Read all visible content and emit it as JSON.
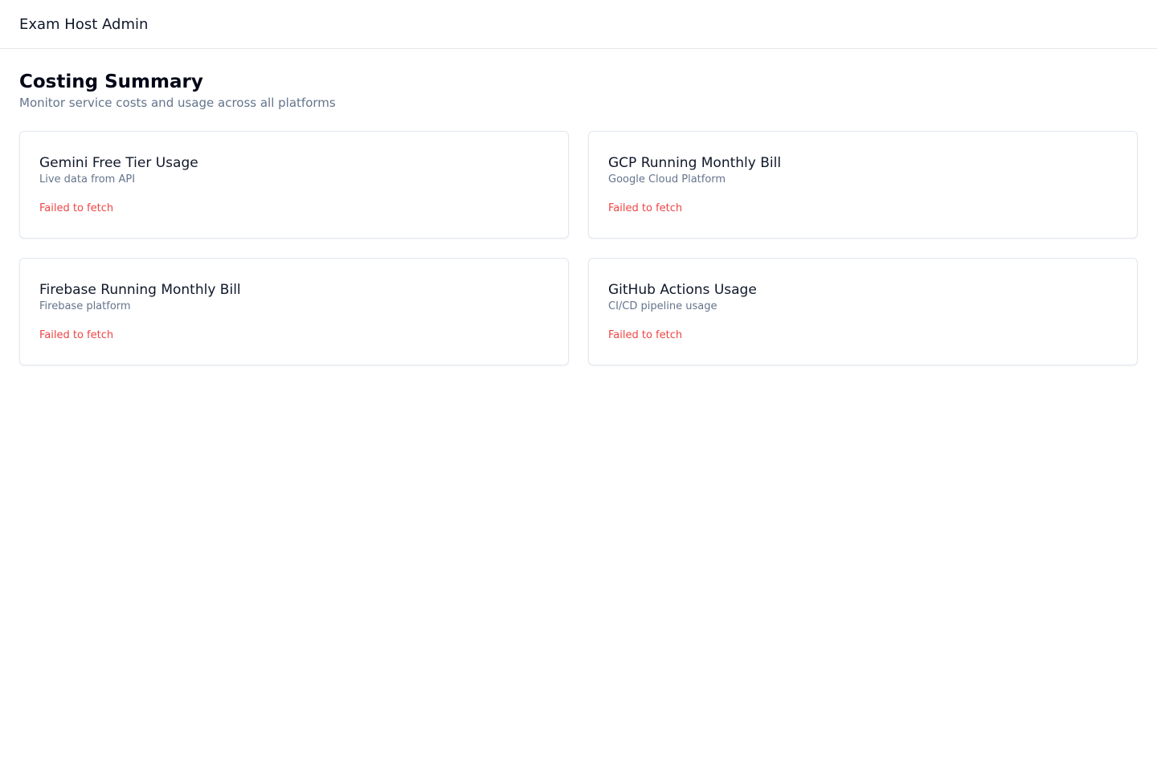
{
  "header": {
    "brand": "Exam Host Admin"
  },
  "page": {
    "title": "Costing Summary",
    "subtitle": "Monitor service costs and usage across all platforms"
  },
  "cards": [
    {
      "title": "Gemini Free Tier Usage",
      "description": "Live data from API",
      "status": "Failed to fetch"
    },
    {
      "title": "GCP Running Monthly Bill",
      "description": "Google Cloud Platform",
      "status": "Failed to fetch"
    },
    {
      "title": "Firebase Running Monthly Bill",
      "description": "Firebase platform",
      "status": "Failed to fetch"
    },
    {
      "title": "GitHub Actions Usage",
      "description": "CI/CD pipeline usage",
      "status": "Failed to fetch"
    }
  ],
  "colors": {
    "error": "#ef4444",
    "muted": "#64748b",
    "border": "#e2e8f0"
  }
}
